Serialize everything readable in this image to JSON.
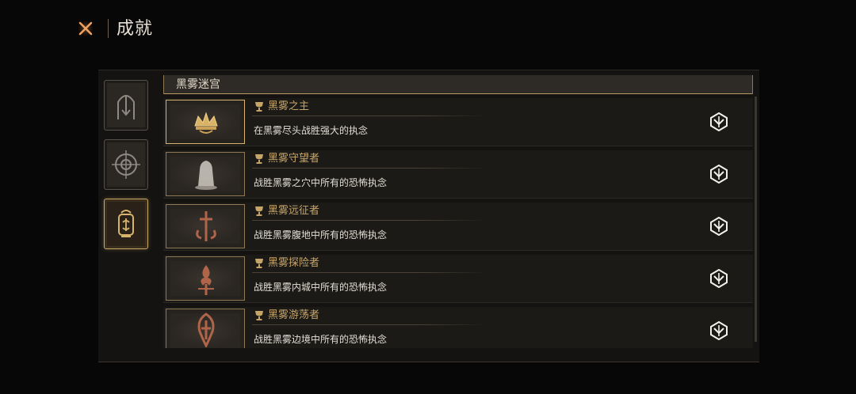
{
  "header": {
    "title": "成就"
  },
  "category": {
    "label": "黑雾迷宫"
  },
  "achievements": [
    {
      "name": "黑雾之主",
      "desc": "在黑雾尽头战胜强大的执念",
      "emblem": "crown-icon"
    },
    {
      "name": "黑雾守望者",
      "desc": "战胜黑雾之穴中所有的恐怖执念",
      "emblem": "hooded-figure-icon"
    },
    {
      "name": "黑雾远征者",
      "desc": "战胜黑雾腹地中所有的恐怖执念",
      "emblem": "sword-emblem-icon"
    },
    {
      "name": "黑雾探险者",
      "desc": "战胜黑雾内城中所有的恐怖执念",
      "emblem": "flame-emblem-icon"
    },
    {
      "name": "黑雾游荡者",
      "desc": "战胜黑雾边境中所有的恐怖执念",
      "emblem": "rune-emblem-icon"
    }
  ],
  "colors": {
    "accent_gold": "#c6a56b",
    "close_orange": "#e8813a"
  }
}
